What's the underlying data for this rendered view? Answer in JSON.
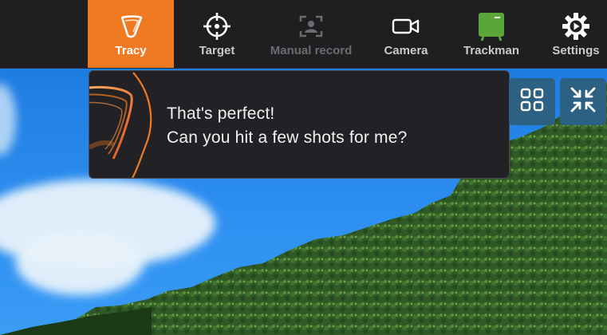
{
  "nav": {
    "items": [
      {
        "label": "Tracy",
        "icon": "tracy-logo-icon",
        "state": "active"
      },
      {
        "label": "Target",
        "icon": "crosshair-icon",
        "state": "normal"
      },
      {
        "label": "Manual record",
        "icon": "person-frame-icon",
        "state": "disabled"
      },
      {
        "label": "Camera",
        "icon": "video-camera-icon",
        "state": "normal"
      },
      {
        "label": "Trackman",
        "icon": "trackman-device-icon",
        "state": "normal"
      },
      {
        "label": "Settings",
        "icon": "gear-icon",
        "state": "normal"
      }
    ]
  },
  "chat": {
    "line1": "That's perfect!",
    "line2": "Can you hit a few shots for me?"
  },
  "buttons": {
    "grid": "grid-view-icon",
    "collapse": "collapse-arrows-icon"
  },
  "colors": {
    "accent": "#f07a21",
    "topbar": "#1f1e21",
    "button_blue": "#2c6184",
    "trackman_green": "#5aa63a"
  }
}
